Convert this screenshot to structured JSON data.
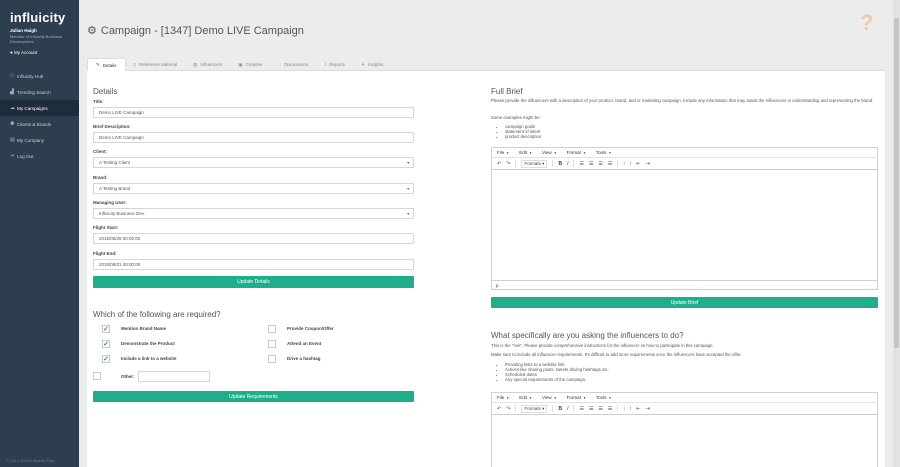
{
  "brand": {
    "logo": "influicity",
    "accent": "#1fae8c",
    "sidebar_bg": "#2d3e4e"
  },
  "user": {
    "name": "Julian Haigh",
    "role": "Member of Influicity Business Development",
    "account_link": "My Account"
  },
  "nav": [
    {
      "label": "Influicity Hub",
      "icon": "hub-icon"
    },
    {
      "label": "Trending Search",
      "icon": "chart-icon"
    },
    {
      "label": "My Campaigns",
      "icon": "campaign-icon",
      "active": true
    },
    {
      "label": "Clients & Brands",
      "icon": "clients-icon"
    },
    {
      "label": "My Company",
      "icon": "company-icon"
    },
    {
      "label": "Log Out",
      "icon": "logout-icon"
    }
  ],
  "footer": {
    "copyright": "© 2014-2015 Influicity Corp."
  },
  "page": {
    "title": "Campaign - [1347] Demo LIVE Campaign",
    "help_glyph": "?"
  },
  "tabs": [
    {
      "label": "Details",
      "active": true
    },
    {
      "label": "Reference Material"
    },
    {
      "label": "Influencers"
    },
    {
      "label": "Creative"
    },
    {
      "label": "Discussions"
    },
    {
      "label": "Reports"
    },
    {
      "label": "Insights"
    }
  ],
  "details": {
    "heading": "Details",
    "title_label": "Title:",
    "title_value": "Demo LIVE Campaign",
    "brief_label": "Brief Description:",
    "brief_value": "Demo LIVE Campaign",
    "client_label": "Client:",
    "client_value": "A Testing Client",
    "brand_label": "Brand:",
    "brand_value": "A Testing Brand",
    "manager_label": "Managing User:",
    "manager_value": "Influicity Business Dev.",
    "start_label": "Flight Start:",
    "start_value": "2015/05/28 00:00:00",
    "end_label": "Flight End:",
    "end_value": "2015/08/31 00:00:00",
    "update_button": "Update Details"
  },
  "requirements": {
    "heading": "Which of the following are required?",
    "items": [
      {
        "label": "Mention Brand Name",
        "checked": true
      },
      {
        "label": "Provide Coupon/Offer",
        "checked": false
      },
      {
        "label": "Demonstrate the Product",
        "checked": true
      },
      {
        "label": "Attend an Event",
        "checked": false
      },
      {
        "label": "Include a link to a website",
        "checked": true
      },
      {
        "label": "Drive a hashtag",
        "checked": false
      }
    ],
    "other_label": "Other:",
    "update_button": "Update Requirements"
  },
  "full_brief": {
    "heading": "Full Brief",
    "description": "Please provide the influencers with a description of your product, brand, and or marketing campaign. Include any information that may assist the influencers in understanding and representing the brand.",
    "examples_intro": "Some examples might be:",
    "examples": [
      "campaign goals",
      "statement of intent",
      "product description"
    ],
    "status_path": "p",
    "update_button": "Update Brief"
  },
  "ask": {
    "heading": "What specifically are you asking the influencers to do?",
    "intro": "This is the \"Ask\". Please provide comprehensive instructions for the influencer on how to participate in this campaign.",
    "note": "Make sure to include all influencer requirements. It's difficult to add more requirements once the influencers have accepted the offer.",
    "examples": [
      "Providing links to a website link",
      "Actions like sharing posts, tweets driving hashtags etc.",
      "Scheduled dates",
      "Any special requirements of the campaign."
    ]
  },
  "editor": {
    "menus": [
      "File",
      "Edit",
      "View",
      "Format",
      "Tools"
    ],
    "formats_label": "Formats",
    "undo_glyph": "↶",
    "redo_glyph": "↷",
    "bold_glyph": "B",
    "italic_glyph": "I"
  }
}
